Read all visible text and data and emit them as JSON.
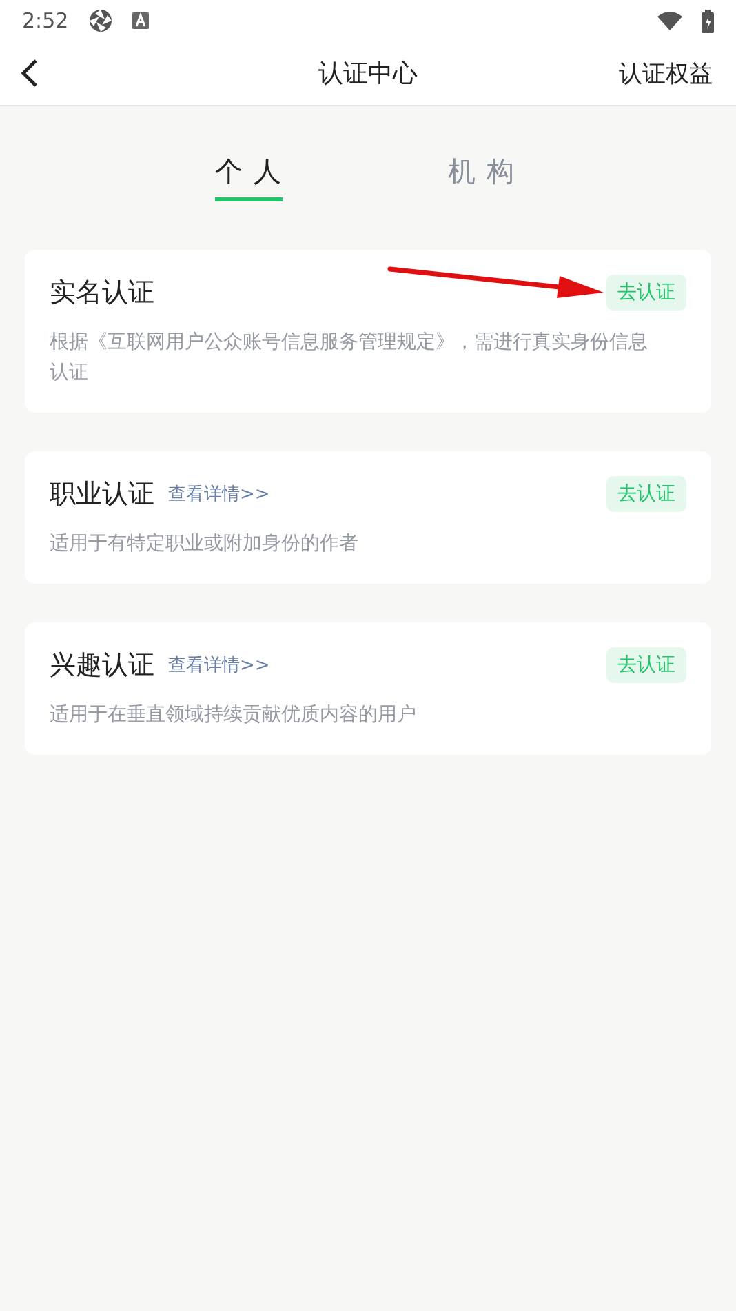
{
  "status_bar": {
    "time": "2:52"
  },
  "nav": {
    "title": "认证中心",
    "action": "认证权益"
  },
  "tabs": [
    {
      "label": "个 人",
      "selected": true
    },
    {
      "label": "机 构",
      "selected": false
    }
  ],
  "cards": [
    {
      "title": "实名认证",
      "description": "根据《互联网用户公众账号信息服务管理规定》，需进行真实身份信息认证",
      "button": "去认证",
      "annotated": true
    },
    {
      "title": "职业认证",
      "link": "查看详情>>",
      "description": "适用于有特定职业或附加身份的作者",
      "button": "去认证",
      "annotated": false
    },
    {
      "title": "兴趣认证",
      "link": "查看详情>>",
      "description": "适用于在垂直领域持续贡献优质内容的用户",
      "button": "去认证",
      "annotated": false
    }
  ]
}
